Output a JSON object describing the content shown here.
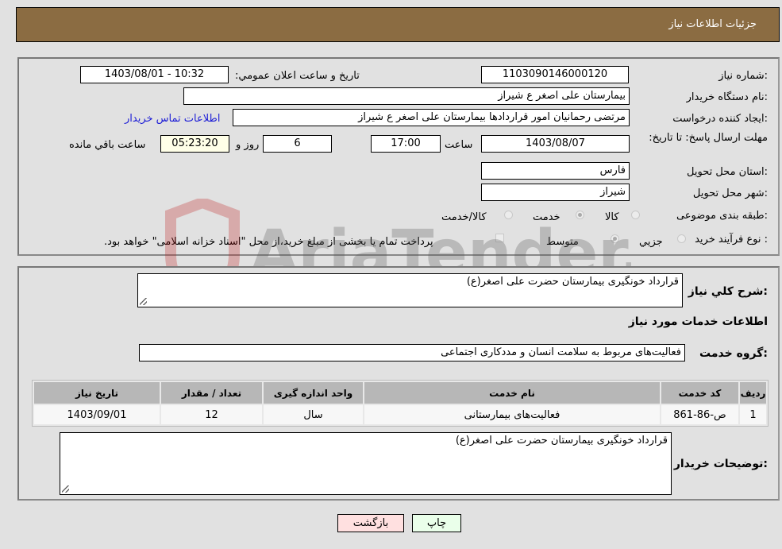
{
  "header": {
    "title": "جزئیات اطلاعات نیاز"
  },
  "form": {
    "need_number": {
      "label": "شماره نیاز:",
      "value": "1103090146000120"
    },
    "announce_datetime": {
      "label": "تاریخ و ساعت اعلان عمومي:",
      "value": "1403/08/01 - 10:32"
    },
    "buyer_org": {
      "label": "نام دستگاه خريدار:",
      "value": "بیمارستان علی اصغر  ع  شیراز"
    },
    "requester": {
      "label": "ایجاد کننده درخواست:",
      "value": "مرتضی رحمانیان امور قراردادها بیمارستان علی اصغر  ع  شیراز",
      "contact_link": "اطلاعات تماس خریدار"
    },
    "deadline": {
      "label": "مهلت ارسال پاسخ: تا تاریخ:",
      "date": "1403/08/07",
      "time_label": "ساعت",
      "time": "17:00",
      "days": "6",
      "days_label": "روز و",
      "remaining": "05:23:20",
      "remaining_label": "ساعت باقي مانده"
    },
    "province": {
      "label": "استان محل تحویل:",
      "value": "فارس"
    },
    "city": {
      "label": "شهر محل تحویل:",
      "value": "شیراز"
    },
    "category": {
      "label": "طبقه بندی موضوعی:",
      "options": [
        {
          "label": "کالا",
          "selected": false
        },
        {
          "label": "خدمت",
          "selected": true
        },
        {
          "label": "کالا/خدمت",
          "selected": false
        }
      ]
    },
    "purchase_type": {
      "label": "نوع فرآیند خرید :",
      "options": [
        {
          "label": "جزيي",
          "selected": false
        },
        {
          "label": "متوسط",
          "selected": true
        }
      ],
      "treasury_note": "پرداخت تمام یا بخشی از مبلغ خرید،از محل \"اسناد خزانه اسلامی\" خواهد بود.",
      "treasury_checked": false
    }
  },
  "details": {
    "summary_label": "شرح کلي نياز:",
    "summary_value": "قرارداد خونگیری بیمارستان حضرت علی اصغر(ع)",
    "services_heading": "اطلاعات خدمات مورد نياز",
    "service_group_label": "گروه خدمت:",
    "service_group_value": "فعالیت‌های مربوط به سلامت انسان و مددکاری اجتماعی",
    "table": {
      "headers": [
        "ردیف",
        "کد خدمت",
        "نام خدمت",
        "واحد اندازه گیری",
        "تعداد / مقدار",
        "تاریخ نیاز"
      ],
      "rows": [
        [
          "1",
          "ص-86-861",
          "فعالیت‌های بیمارستانی",
          "سال",
          "12",
          "1403/09/01"
        ]
      ]
    },
    "buyer_notes_label": "توضیحات خریدار:",
    "buyer_notes_value": "قرارداد خونگیری بیمارستان حضرت علی اصغر(ع)"
  },
  "buttons": {
    "print": "چاپ",
    "back": "بازگشت"
  },
  "colors": {
    "header_bg": "#8b6c42",
    "print_bg": "#eaffea",
    "back_bg": "#ffe0e0",
    "link": "#1c1cd6"
  },
  "watermark": {
    "text": "AriaTender.neT"
  }
}
